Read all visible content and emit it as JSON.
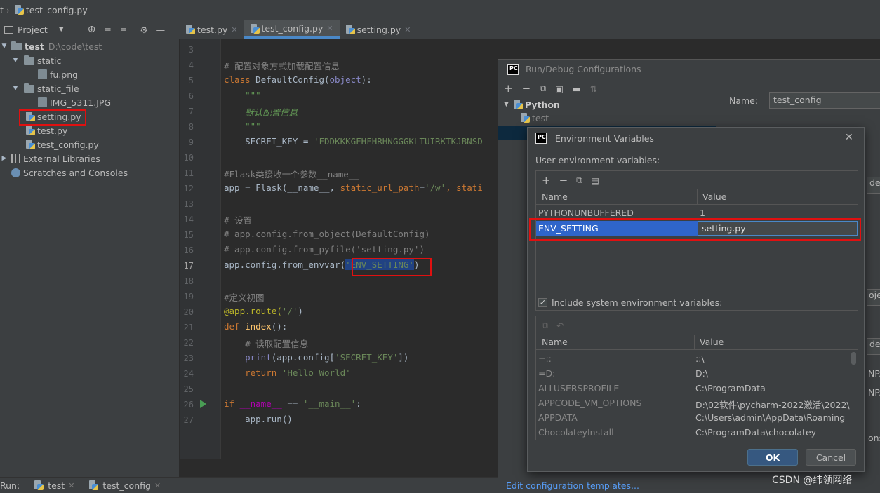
{
  "breadcrumb": {
    "root": "t",
    "file": "test_config.py"
  },
  "project_toolbar": {
    "label": "Project"
  },
  "tabs": [
    {
      "label": "test.py",
      "active": false
    },
    {
      "label": "test_config.py",
      "active": true
    },
    {
      "label": "setting.py",
      "active": false
    }
  ],
  "tree": {
    "root_name": "test",
    "root_path": "D:\\code\\test",
    "items": [
      {
        "label": "static"
      },
      {
        "label": "fu.png"
      },
      {
        "label": "static_file"
      },
      {
        "label": "IMG_5311.JPG"
      },
      {
        "label": "setting.py"
      },
      {
        "label": "test.py"
      },
      {
        "label": "test_config.py"
      },
      {
        "label": "External Libraries"
      },
      {
        "label": "Scratches and Consoles"
      }
    ]
  },
  "editor": {
    "line_numbers": [
      "3",
      "4",
      "5",
      "6",
      "7",
      "8",
      "9",
      "10",
      "11",
      "12",
      "13",
      "14",
      "15",
      "16",
      "17",
      "18",
      "19",
      "20",
      "21",
      "22",
      "23",
      "24",
      "25",
      "26",
      "27"
    ],
    "lines": {
      "l4": "# 配置对象方式加载配置信息",
      "l5a": "class ",
      "l5b": "DefaultConfig(",
      "l5c": "object",
      "l5d": "):",
      "l6": "    \"\"\"",
      "l7": "    默认配置信息",
      "l8": "    \"\"\"",
      "l9a": "    SECRET_KEY = ",
      "l9b": "'FDDKKKGFHFHRHNGGGKLTUIRKTKJBNSD",
      "l11": "#Flask类接收一个参数__name__",
      "l12a": "app = Flask(__name__, ",
      "l12b": "static_url_path",
      "l12c": "=",
      "l12d": "'/w'",
      "l12e": ", stati",
      "l14": "# 设置",
      "l15": "# app.config.from_object(DefaultConfig)",
      "l16": "# app.config.from_pyfile('setting.py')",
      "l17a": "app.config.from_envvar(",
      "l17b": "'ENV_SETTING'",
      "l17c": ")",
      "l19": "#定义视图",
      "l20a": "@app.route(",
      "l20b": "'/'",
      "l20c": ")",
      "l21a": "def ",
      "l21b": "index",
      "l21c": "():",
      "l22": "    # 读取配置信息",
      "l23a": "    ",
      "l23b": "print",
      "l23c": "(app.config[",
      "l23d": "'SECRET_KEY'",
      "l23e": "])",
      "l24a": "    return ",
      "l24b": "'Hello World'",
      "l26a": "if ",
      "l26b": "__name__",
      "l26c": " == ",
      "l26d": "'__main__'",
      "l26e": ":",
      "l27": "    app.run()"
    }
  },
  "run_bar": {
    "label": "Run:",
    "tabs": [
      "test",
      "test_config"
    ]
  },
  "run_debug_dialog": {
    "title": "Run/Debug Configurations",
    "tree_group": "Python",
    "tree_item": "test",
    "name_label": "Name:",
    "name_value": "test_config",
    "edit_templates_link": "Edit configuration templates...",
    "right_clipped": [
      "de\\",
      "oje",
      "de\\",
      "NPA",
      "NPA",
      "ons"
    ]
  },
  "env_dialog": {
    "title": "Environment Variables",
    "user_label": "User environment variables:",
    "col_name": "Name",
    "col_value": "Value",
    "user_vars": [
      {
        "name": "PYTHONUNBUFFERED",
        "value": "1"
      },
      {
        "name": "ENV_SETTING",
        "value": "setting.py"
      }
    ],
    "include_label": "Include system environment variables:",
    "include_checked": true,
    "sys_vars": [
      {
        "name": "=::",
        "value": "::\\"
      },
      {
        "name": "=D:",
        "value": "D:\\"
      },
      {
        "name": "ALLUSERSPROFILE",
        "value": "C:\\ProgramData"
      },
      {
        "name": "APPCODE_VM_OPTIONS",
        "value": "D:\\02软件\\pycharm-2022激活\\2022\\..."
      },
      {
        "name": "APPDATA",
        "value": "C:\\Users\\admin\\AppData\\Roaming"
      },
      {
        "name": "ChocolateyInstall",
        "value": "C:\\ProgramData\\chocolatey"
      }
    ],
    "ok_label": "OK",
    "cancel_label": "Cancel"
  },
  "watermark": "CSDN @纬领网络",
  "colors": {
    "selection_blue": "#2f65ca",
    "highlight_red": "#e01010",
    "accent": "#365880"
  }
}
